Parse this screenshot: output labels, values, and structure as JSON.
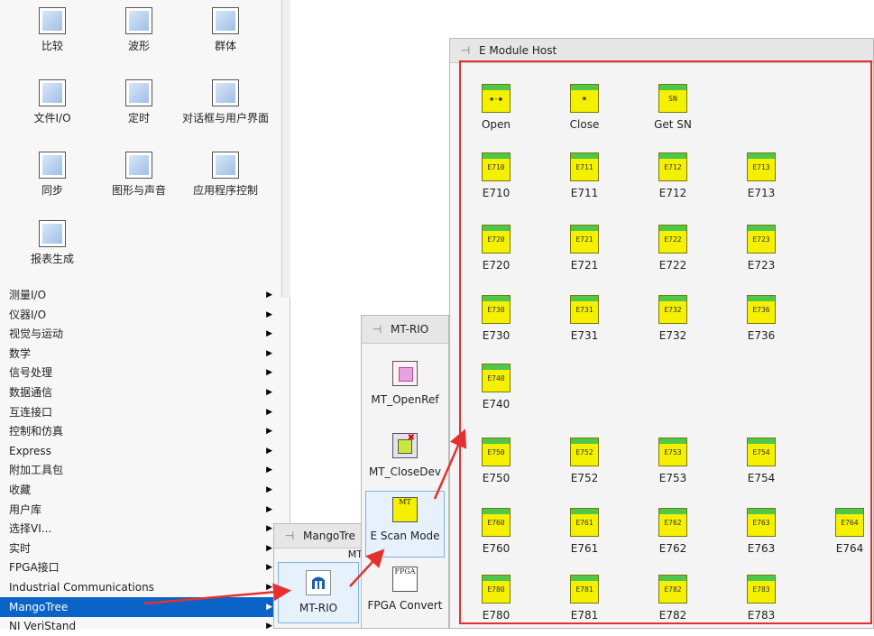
{
  "palette": {
    "icons": [
      {
        "label": "比较",
        "icon": "compare-icon"
      },
      {
        "label": "波形",
        "icon": "waveform-icon"
      },
      {
        "label": "群体",
        "icon": "cluster-icon"
      },
      {
        "label": "文件I/O",
        "icon": "file-io-icon"
      },
      {
        "label": "定时",
        "icon": "timing-icon"
      },
      {
        "label": "对话框与用户界面",
        "icon": "dialog-icon"
      },
      {
        "label": "同步",
        "icon": "sync-icon"
      },
      {
        "label": "图形与声音",
        "icon": "graphics-sound-icon"
      },
      {
        "label": "应用程序控制",
        "icon": "app-control-icon"
      },
      {
        "label": "报表生成",
        "icon": "report-icon"
      }
    ],
    "menu": [
      {
        "label": "测量I/O"
      },
      {
        "label": "仪器I/O"
      },
      {
        "label": "视觉与运动"
      },
      {
        "label": "数学"
      },
      {
        "label": "信号处理"
      },
      {
        "label": "数据通信"
      },
      {
        "label": "互连接口"
      },
      {
        "label": "控制和仿真"
      },
      {
        "label": "Express"
      },
      {
        "label": "附加工具包"
      },
      {
        "label": "收藏"
      },
      {
        "label": "用户库"
      },
      {
        "label": "选择VI..."
      },
      {
        "label": "实时"
      },
      {
        "label": "FPGA接口"
      },
      {
        "label": "Industrial Communications"
      },
      {
        "label": "MangoTree"
      },
      {
        "label": "NI VeriStand"
      }
    ],
    "selected_index": 16
  },
  "mangotree_panel": {
    "title": "MangoTre",
    "subtitle": "MT",
    "item": {
      "label": "MT-RIO",
      "icon": "mt-rio-logo-icon"
    }
  },
  "mtrio_panel": {
    "title": "MT-RIO",
    "items": [
      {
        "label": "MT_OpenRef",
        "icon": "open-ref-icon"
      },
      {
        "label": "MT_CloseDev",
        "icon": "close-dev-icon"
      },
      {
        "label": "E Scan Mode",
        "icon": "scan-mode-icon",
        "icon_text": "MT"
      },
      {
        "label": "FPGA Convert",
        "icon": "fpga-convert-icon",
        "icon_text": "FPGA"
      }
    ]
  },
  "emodule_panel": {
    "title": "E Module Host",
    "rows": [
      [
        {
          "label": "Open",
          "code": "✹-◆"
        },
        {
          "label": "Close",
          "code": "✖"
        },
        {
          "label": "Get SN",
          "code": "SN"
        }
      ],
      [
        {
          "label": "E710",
          "code": "E710"
        },
        {
          "label": "E711",
          "code": "E711"
        },
        {
          "label": "E712",
          "code": "E712"
        },
        {
          "label": "E713",
          "code": "E713"
        }
      ],
      [
        {
          "label": "E720",
          "code": "E720"
        },
        {
          "label": "E721",
          "code": "E721"
        },
        {
          "label": "E722",
          "code": "E722"
        },
        {
          "label": "E723",
          "code": "E723"
        }
      ],
      [
        {
          "label": "E730",
          "code": "E730"
        },
        {
          "label": "E731",
          "code": "E731"
        },
        {
          "label": "E732",
          "code": "E732"
        },
        {
          "label": "E736",
          "code": "E736"
        }
      ],
      [
        {
          "label": "E740",
          "code": "E740"
        }
      ],
      [
        {
          "label": "E750",
          "code": "E750"
        },
        {
          "label": "E752",
          "code": "E752"
        },
        {
          "label": "E753",
          "code": "E753"
        },
        {
          "label": "E754",
          "code": "E754"
        }
      ],
      [
        {
          "label": "E760",
          "code": "E760"
        },
        {
          "label": "E761",
          "code": "E761"
        },
        {
          "label": "E762",
          "code": "E762"
        },
        {
          "label": "E763",
          "code": "E763"
        },
        {
          "label": "E764",
          "code": "E764"
        }
      ],
      [
        {
          "label": "E780",
          "code": "E780"
        },
        {
          "label": "E781",
          "code": "E781"
        },
        {
          "label": "E782",
          "code": "E782"
        },
        {
          "label": "E783",
          "code": "E783"
        }
      ]
    ]
  },
  "colors": {
    "selection": "#0a64c8",
    "highlight_box": "#e53030",
    "arrow": "#e53030",
    "icon_yellow": "#f4f000",
    "icon_green": "#4dc84d"
  }
}
